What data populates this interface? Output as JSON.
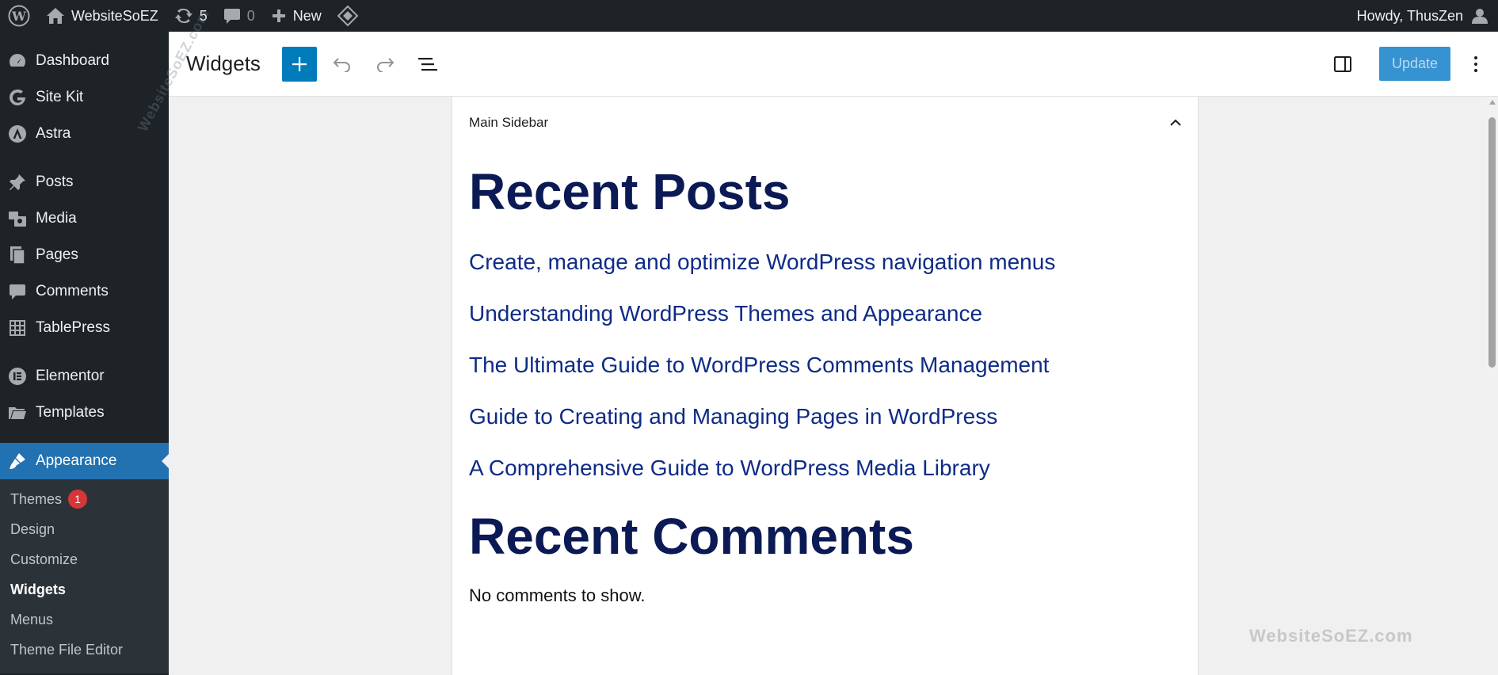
{
  "adminbar": {
    "site_name": "WebsiteSoEZ",
    "updates_count": "5",
    "comments_count": "0",
    "new_label": "New",
    "howdy": "Howdy, ThusZen"
  },
  "sidebar": {
    "items": [
      {
        "label": "Dashboard",
        "icon": "dashboard-icon"
      },
      {
        "label": "Site Kit",
        "icon": "google-g-icon"
      },
      {
        "label": "Astra",
        "icon": "astra-icon"
      },
      {
        "label": "Posts",
        "icon": "pin-icon"
      },
      {
        "label": "Media",
        "icon": "media-icon"
      },
      {
        "label": "Pages",
        "icon": "pages-icon"
      },
      {
        "label": "Comments",
        "icon": "comment-icon"
      },
      {
        "label": "TablePress",
        "icon": "table-icon"
      },
      {
        "label": "Elementor",
        "icon": "elementor-icon"
      },
      {
        "label": "Templates",
        "icon": "folder-icon"
      },
      {
        "label": "Appearance",
        "icon": "brush-icon"
      }
    ],
    "submenu": [
      {
        "label": "Themes",
        "badge": "1"
      },
      {
        "label": "Design"
      },
      {
        "label": "Customize"
      },
      {
        "label": "Widgets"
      },
      {
        "label": "Menus"
      },
      {
        "label": "Theme File Editor"
      }
    ]
  },
  "header": {
    "title": "Widgets",
    "update_label": "Update"
  },
  "panel": {
    "area_title": "Main Sidebar",
    "recent_posts_title": "Recent Posts",
    "posts": [
      "Create, manage and optimize WordPress navigation menus",
      "Understanding WordPress Themes and Appearance",
      "The Ultimate Guide to WordPress Comments Management",
      "Guide to Creating and Managing Pages in WordPress",
      "A Comprehensive Guide to WordPress Media Library"
    ],
    "recent_comments_title": "Recent Comments",
    "no_comments": "No comments to show."
  },
  "watermarks": {
    "diagonal": "WebsiteSoEZ.com",
    "corner": "WebsiteSoEZ.com"
  },
  "colors": {
    "admin_dark": "#1d2327",
    "accent_blue": "#2271b1",
    "heading_navy": "#0b1a54",
    "link_blue": "#0e2b86",
    "badge_red": "#d63638"
  }
}
